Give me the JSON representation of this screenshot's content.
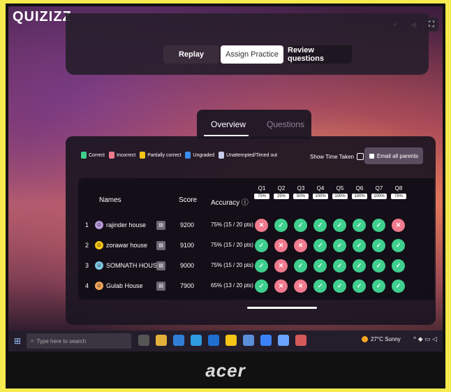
{
  "app": {
    "logo": "QUIZIZZ"
  },
  "top_icons": [
    "magic-icon",
    "volume-icon",
    "fullscreen-icon"
  ],
  "top_buttons": {
    "replay": "Replay",
    "assign": "Assign Practice",
    "review": "Review questions"
  },
  "tabs": {
    "overview": "Overview",
    "questions": "Questions"
  },
  "legend": [
    {
      "label": "Correct",
      "color": "#3fcf8e"
    },
    {
      "label": "Incorrect",
      "color": "#f07a8e"
    },
    {
      "label": "Partially correct",
      "color": "#f5c518"
    },
    {
      "label": "Ungraded",
      "color": "#3a8df0"
    },
    {
      "label": "Unattempted/Timed out",
      "color": "#c9cbe8"
    }
  ],
  "show_time_label": "Show Time Taken",
  "email_label": "Email all parents",
  "table": {
    "headers": {
      "names": "Names",
      "score": "Score",
      "accuracy": "Accuracy ⓘ"
    },
    "questions": [
      {
        "label": "Q1",
        "pct": "75%"
      },
      {
        "label": "Q2",
        "pct": "25%"
      },
      {
        "label": "Q3",
        "pct": "50%"
      },
      {
        "label": "Q4",
        "pct": "100%"
      },
      {
        "label": "Q5",
        "pct": "100%"
      },
      {
        "label": "Q6",
        "pct": "100%"
      },
      {
        "label": "Q7",
        "pct": "100%"
      },
      {
        "label": "Q8",
        "pct": "75%"
      }
    ],
    "rows": [
      {
        "rank": "1",
        "name": "rajinder house",
        "score": "9200",
        "accuracy": "75% (15 / 20 pts)",
        "avatar_color": "#b89bd9",
        "results": [
          "x",
          "c",
          "c",
          "c",
          "c",
          "c",
          "c",
          "x"
        ]
      },
      {
        "rank": "2",
        "name": "zorawar house",
        "score": "9100",
        "accuracy": "75% (15 / 20 pts)",
        "avatar_color": "#f5c518",
        "results": [
          "c",
          "x",
          "x",
          "c",
          "c",
          "c",
          "c",
          "c"
        ]
      },
      {
        "rank": "3",
        "name": "SOMNATH HOUSE",
        "score": "9000",
        "accuracy": "75% (15 / 20 pts)",
        "avatar_color": "#7ec8e3",
        "results": [
          "c",
          "x",
          "c",
          "c",
          "c",
          "c",
          "c",
          "c"
        ]
      },
      {
        "rank": "4",
        "name": "Gulab House",
        "score": "7900",
        "accuracy": "65% (13 / 20 pts)",
        "avatar_color": "#f2a65a",
        "results": [
          "c",
          "x",
          "x",
          "c",
          "c",
          "c",
          "c",
          "c"
        ]
      }
    ]
  },
  "taskbar": {
    "search_placeholder": "Type here to search",
    "apps": [
      "task-view-icon",
      "file-explorer-icon",
      "edge-icon",
      "store-icon",
      "mail-icon",
      "chrome-icon",
      "app-icon",
      "app-icon",
      "app-icon",
      "app-icon"
    ],
    "weather": "27°C Sunny"
  },
  "brand": "acer",
  "colors": {
    "correct": "#3fcf8e",
    "incorrect": "#f07a8e"
  }
}
